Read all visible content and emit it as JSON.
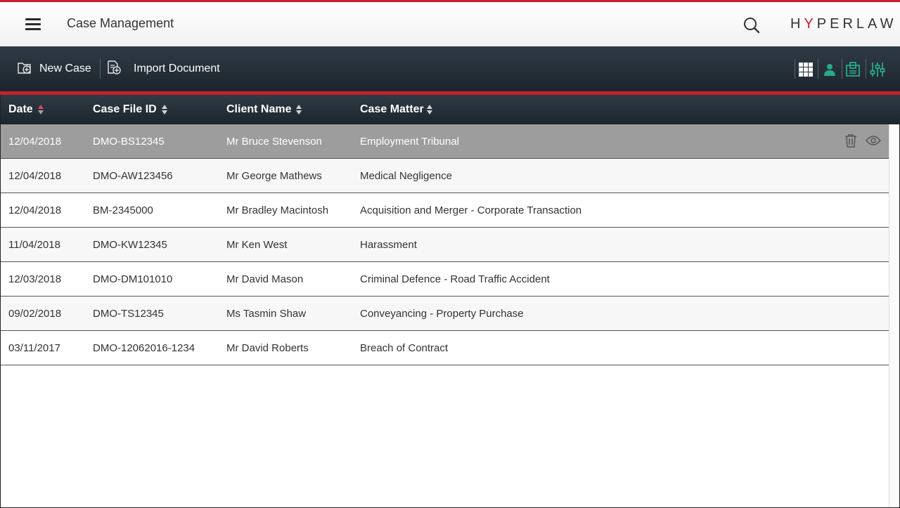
{
  "header": {
    "title": "Case Management",
    "logo_text_pre": "H",
    "logo_text_y": "Y",
    "logo_text_post": "PERLAW"
  },
  "toolbar": {
    "new_case_label": "New Case",
    "import_document_label": "Import Document"
  },
  "colors": {
    "accent": "#c8202f",
    "toolbar_bg": "#1c252d",
    "selected_row": "#9d9d9d",
    "view_icon_active": "#2aa889"
  },
  "table": {
    "columns": [
      "Date",
      "Case File ID",
      "Client Name",
      "Case Matter"
    ],
    "rows": [
      {
        "date": "12/04/2018",
        "id": "DMO-BS12345",
        "client": "Mr Bruce Stevenson",
        "matter": "Employment Tribunal"
      },
      {
        "date": "12/04/2018",
        "id": "DMO-AW123456",
        "client": "Mr George Mathews",
        "matter": "Medical Negligence"
      },
      {
        "date": "12/04/2018",
        "id": "BM-2345000",
        "client": "Mr Bradley Macintosh",
        "matter": "Acquisition and Merger - Corporate Transaction"
      },
      {
        "date": "11/04/2018",
        "id": "DMO-KW12345",
        "client": "Mr Ken West",
        "matter": "Harassment"
      },
      {
        "date": "12/03/2018",
        "id": "DMO-DM101010",
        "client": "Mr David Mason",
        "matter": "Criminal Defence - Road Traffic Accident"
      },
      {
        "date": "09/02/2018",
        "id": "DMO-TS12345",
        "client": "Ms Tasmin Shaw",
        "matter": "Conveyancing - Property Purchase"
      },
      {
        "date": "03/11/2017",
        "id": "DMO-12062016-1234",
        "client": "Mr David Roberts",
        "matter": "Breach of Contract"
      }
    ]
  }
}
